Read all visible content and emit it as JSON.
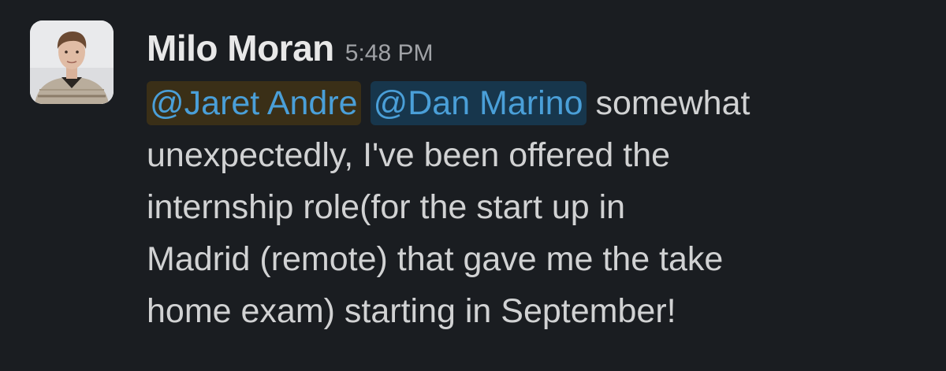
{
  "message": {
    "author": "Milo Moran",
    "timestamp": "5:48 PM",
    "mentions": [
      "@Jaret Andre",
      "@Dan Marino"
    ],
    "lines": [
      " somewhat",
      "unexpectedly, I've been offered the",
      "internship role(for the start up in",
      "Madrid (remote) that gave me the take",
      "home exam) starting in September!"
    ]
  },
  "colors": {
    "background": "#1a1d21",
    "mention_text": "#4a9fd8",
    "mention_highlight_1": "#3a2f17",
    "mention_highlight_2": "#17364c"
  }
}
